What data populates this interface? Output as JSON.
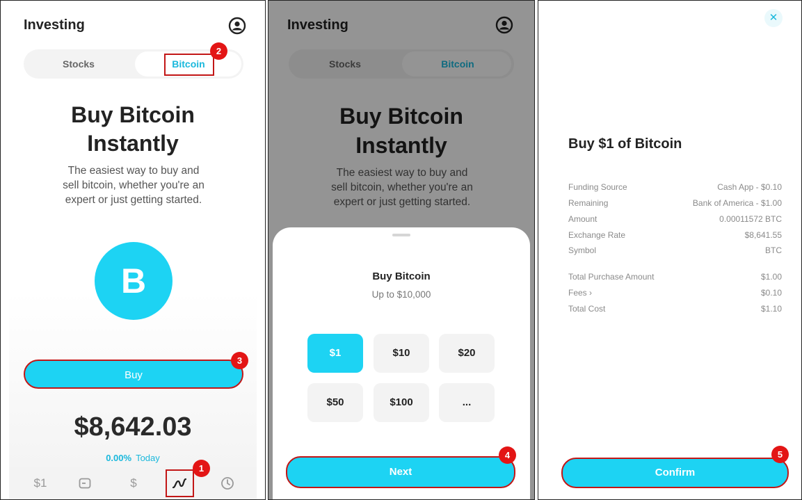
{
  "panel1": {
    "title": "Investing",
    "tabs": {
      "stocks": "Stocks",
      "bitcoin": "Bitcoin"
    },
    "hero_line1": "Buy Bitcoin",
    "hero_line2": "Instantly",
    "description_lines": [
      "The easiest way to buy and",
      "sell bitcoin, whether you're an",
      "expert or just getting started."
    ],
    "bitcoin_symbol": "B",
    "buy_label": "Buy",
    "price": "$8,642.03",
    "change_pct": "0.00%",
    "change_period": "Today",
    "bottom_nav": {
      "cash_label": "$1",
      "dollar_glyph": "$"
    }
  },
  "panel2": {
    "title": "Investing",
    "tabs": {
      "stocks": "Stocks",
      "bitcoin": "Bitcoin"
    },
    "hero_line1": "Buy Bitcoin",
    "hero_line2": "Instantly",
    "description_lines": [
      "The easiest way to buy and",
      "sell bitcoin, whether you're an",
      "expert or just getting started."
    ],
    "sheet_title": "Buy Bitcoin",
    "sheet_subtitle": "Up to $10,000",
    "amounts": [
      "$1",
      "$10",
      "$20",
      "$50",
      "$100",
      "..."
    ],
    "selected_amount": "$1",
    "next_label": "Next"
  },
  "panel3": {
    "close_glyph": "✕",
    "title": "Buy $1 of Bitcoin",
    "details": [
      {
        "label": "Funding Source",
        "value": "Cash App - $0.10"
      },
      {
        "label": "Remaining",
        "value": "Bank of America - $1.00"
      },
      {
        "label": "Amount",
        "value": "0.00011572 BTC"
      },
      {
        "label": "Exchange Rate",
        "value": "$8,641.55"
      },
      {
        "label": "Symbol",
        "value": "BTC"
      }
    ],
    "totals": [
      {
        "label": "Total Purchase Amount",
        "value": "$1.00"
      },
      {
        "label": "Fees ›",
        "value": "$0.10"
      },
      {
        "label": "Total Cost",
        "value": "$1.10"
      }
    ],
    "confirm_label": "Confirm"
  },
  "annotations": [
    "1",
    "2",
    "3",
    "4",
    "5"
  ],
  "colors": {
    "accent": "#1dd3f3",
    "accent_text": "#1ab8dc",
    "annotation": "#e31515"
  }
}
